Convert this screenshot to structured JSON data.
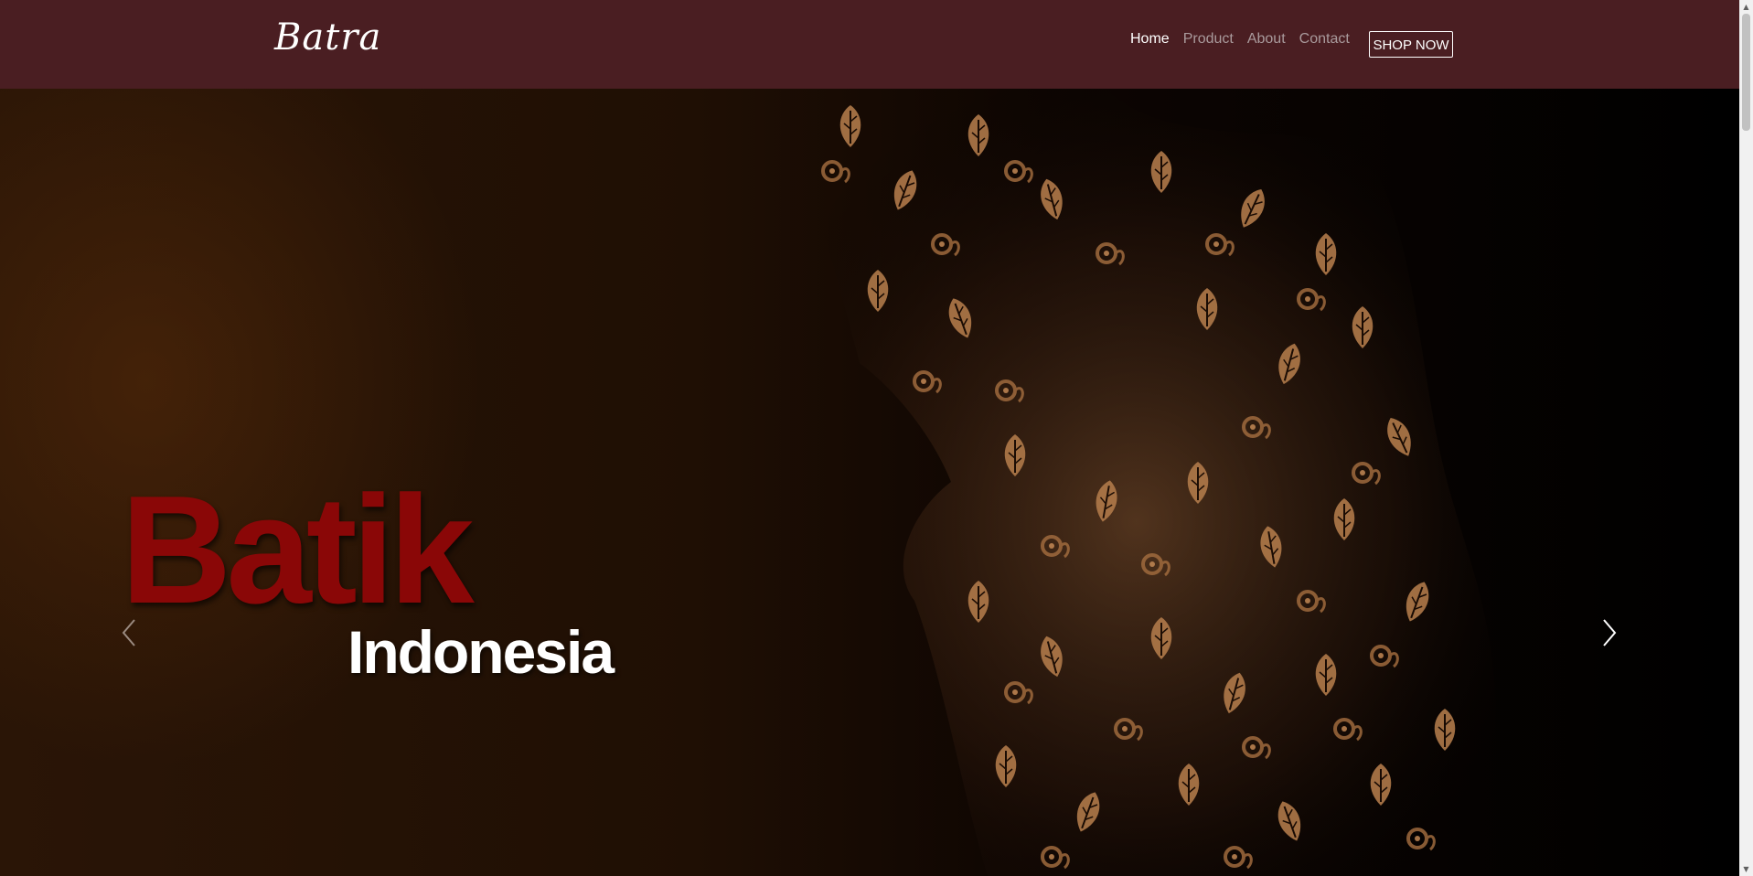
{
  "navbar": {
    "brand": "Batra",
    "links": [
      {
        "label": "Home",
        "active": true
      },
      {
        "label": "Product",
        "active": false
      },
      {
        "label": "About",
        "active": false
      },
      {
        "label": "Contact",
        "active": false
      }
    ],
    "shop_button": "SHOP NOW"
  },
  "hero": {
    "title_main": "Batik",
    "title_sub": "Indonesia",
    "prev_icon": "chevron-left-icon",
    "next_icon": "chevron-right-icon"
  },
  "colors": {
    "navbar_bg": "#4a1e22",
    "title_red": "#8a0707",
    "pattern_gold": "#b07a4a"
  },
  "scrollbar": {
    "up_icon": "▲",
    "down_icon": "▼"
  }
}
